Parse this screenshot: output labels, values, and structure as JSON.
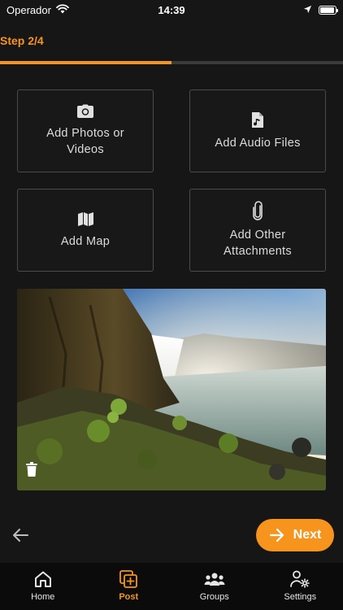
{
  "status": {
    "carrier": "Operador",
    "time": "14:39",
    "battery_level": 0.95
  },
  "step": {
    "label": "Step 2/4",
    "progress": 0.5
  },
  "tiles": [
    {
      "label": "Add Photos or Videos",
      "icon": "camera-icon"
    },
    {
      "label": "Add Audio Files",
      "icon": "audio-file-icon"
    },
    {
      "label": "Add Map",
      "icon": "map-icon"
    },
    {
      "label": "Add Other Attachments",
      "icon": "paperclip-icon"
    }
  ],
  "photo": {
    "delete_icon": "trash-icon"
  },
  "nav": {
    "back_icon": "arrow-left-icon",
    "next_label": "Next",
    "next_icon": "arrow-right-icon"
  },
  "tabs": [
    {
      "label": "Home",
      "icon": "home-icon",
      "active": false
    },
    {
      "label": "Post",
      "icon": "post-icon",
      "active": true
    },
    {
      "label": "Groups",
      "icon": "groups-icon",
      "active": false
    },
    {
      "label": "Settings",
      "icon": "settings-icon",
      "active": false
    }
  ],
  "colors": {
    "accent": "#f7941d",
    "background": "#161616",
    "tile_border": "#4b4b4b",
    "tab_bar": "#0b0b0b"
  }
}
